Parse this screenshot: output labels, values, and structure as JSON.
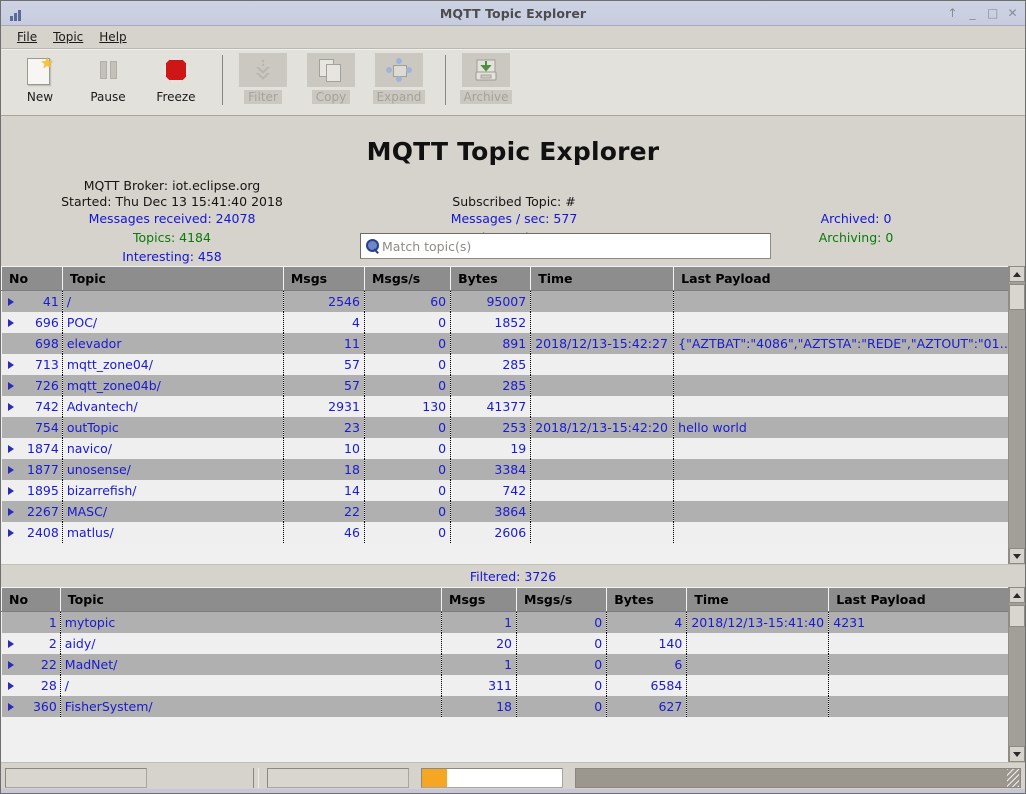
{
  "window": {
    "title": "MQTT Topic Explorer",
    "icon": "chart-bars-icon",
    "controls": [
      {
        "name": "restore-up-button",
        "glyph": "↑"
      },
      {
        "name": "minimize-button",
        "glyph": "_"
      },
      {
        "name": "maximize-button",
        "glyph": "□"
      },
      {
        "name": "close-button",
        "glyph": "✕"
      }
    ]
  },
  "menu": {
    "items": [
      {
        "label": "File",
        "mnemonic": "F"
      },
      {
        "label": "Topic",
        "mnemonic": "T"
      },
      {
        "label": "Help",
        "mnemonic": "H"
      }
    ]
  },
  "toolbar": {
    "buttons": [
      {
        "label": "New",
        "icon": "new-document-icon",
        "enabled": true
      },
      {
        "label": "Pause",
        "icon": "pause-icon",
        "enabled": true
      },
      {
        "label": "Freeze",
        "icon": "freeze-stop-icon",
        "enabled": true
      },
      {
        "label": "Filter",
        "icon": "filter-down-arrow-icon",
        "enabled": false
      },
      {
        "label": "Copy",
        "icon": "copy-pages-icon",
        "enabled": false
      },
      {
        "label": "Expand",
        "icon": "expand-arrows-icon",
        "enabled": false
      },
      {
        "label": "Archive",
        "icon": "archive-download-icon",
        "enabled": false
      }
    ]
  },
  "header": {
    "app_title": "MQTT Topic Explorer",
    "broker_line": "MQTT Broker: iot.eclipse.org",
    "started_line": "Started: Thu Dec 13 15:41:40 2018",
    "messages_received": "Messages received: 24078",
    "topics": "Topics: 4184",
    "interesting": "Interesting: 458",
    "subscribed_topic": "Subscribed Topic: #",
    "messages_per_sec": "Messages / sec: 577",
    "active_topics": "Active topics: 56",
    "archived": "Archived: 0",
    "archiving": "Archiving: 0",
    "colors": {
      "blue": "#1415d8",
      "green": "#0a7a0a",
      "black": "#151515"
    }
  },
  "search": {
    "placeholder": "Match topic(s)",
    "value": "",
    "icon": "search-magnifier-icon"
  },
  "topics_table": {
    "columns": [
      "No",
      "Topic",
      "Msgs",
      "Msgs/s",
      "Bytes",
      "Time",
      "Last Payload"
    ],
    "rows": [
      {
        "expand": true,
        "no": "41",
        "topic": "/",
        "msgs": "2546",
        "msgs_s": "60",
        "bytes": "95007",
        "time": "",
        "payload": ""
      },
      {
        "expand": true,
        "no": "696",
        "topic": "POC/",
        "msgs": "4",
        "msgs_s": "0",
        "bytes": "1852",
        "time": "",
        "payload": ""
      },
      {
        "expand": false,
        "no": "698",
        "topic": "elevador",
        "msgs": "11",
        "msgs_s": "0",
        "bytes": "891",
        "time": "2018/12/13-15:42:27",
        "payload": "{\"AZTBAT\":\"4086\",\"AZTSTA\":\"REDE\",\"AZTOUT\":\"01…"
      },
      {
        "expand": true,
        "no": "713",
        "topic": "mqtt_zone04/",
        "msgs": "57",
        "msgs_s": "0",
        "bytes": "285",
        "time": "",
        "payload": ""
      },
      {
        "expand": true,
        "no": "726",
        "topic": "mqtt_zone04b/",
        "msgs": "57",
        "msgs_s": "0",
        "bytes": "285",
        "time": "",
        "payload": ""
      },
      {
        "expand": true,
        "no": "742",
        "topic": "Advantech/",
        "msgs": "2931",
        "msgs_s": "130",
        "bytes": "41377",
        "time": "",
        "payload": ""
      },
      {
        "expand": false,
        "no": "754",
        "topic": "outTopic",
        "msgs": "23",
        "msgs_s": "0",
        "bytes": "253",
        "time": "2018/12/13-15:42:20",
        "payload": "hello world"
      },
      {
        "expand": true,
        "no": "1874",
        "topic": "navico/",
        "msgs": "10",
        "msgs_s": "0",
        "bytes": "19",
        "time": "",
        "payload": ""
      },
      {
        "expand": true,
        "no": "1877",
        "topic": "unosense/",
        "msgs": "18",
        "msgs_s": "0",
        "bytes": "3384",
        "time": "",
        "payload": ""
      },
      {
        "expand": true,
        "no": "1895",
        "topic": "bizarrefish/",
        "msgs": "14",
        "msgs_s": "0",
        "bytes": "742",
        "time": "",
        "payload": ""
      },
      {
        "expand": true,
        "no": "2267",
        "topic": "MASC/",
        "msgs": "22",
        "msgs_s": "0",
        "bytes": "3864",
        "time": "",
        "payload": ""
      },
      {
        "expand": true,
        "no": "2408",
        "topic": "matlus/",
        "msgs": "46",
        "msgs_s": "0",
        "bytes": "2606",
        "time": "",
        "payload": ""
      }
    ]
  },
  "filtered_label": "Filtered: 3726",
  "filtered_table": {
    "columns": [
      "No",
      "Topic",
      "Msgs",
      "Msgs/s",
      "Bytes",
      "Time",
      "Last Payload"
    ],
    "rows": [
      {
        "expand": false,
        "no": "1",
        "topic": "mytopic",
        "msgs": "1",
        "msgs_s": "0",
        "bytes": "4",
        "time": "2018/12/13-15:41:40",
        "payload": "4231"
      },
      {
        "expand": true,
        "no": "2",
        "topic": "aidy/",
        "msgs": "20",
        "msgs_s": "0",
        "bytes": "140",
        "time": "",
        "payload": ""
      },
      {
        "expand": true,
        "no": "22",
        "topic": "MadNet/",
        "msgs": "1",
        "msgs_s": "0",
        "bytes": "6",
        "time": "",
        "payload": ""
      },
      {
        "expand": true,
        "no": "28",
        "topic": "/",
        "msgs": "311",
        "msgs_s": "0",
        "bytes": "6584",
        "time": "",
        "payload": ""
      },
      {
        "expand": true,
        "no": "360",
        "topic": "FisherSystem/",
        "msgs": "18",
        "msgs_s": "0",
        "bytes": "627",
        "time": "",
        "payload": ""
      }
    ]
  },
  "statusbar": {
    "panels": [
      "",
      "",
      "",
      ""
    ],
    "progress_percent": 18,
    "progress_color": "#f5a623"
  }
}
